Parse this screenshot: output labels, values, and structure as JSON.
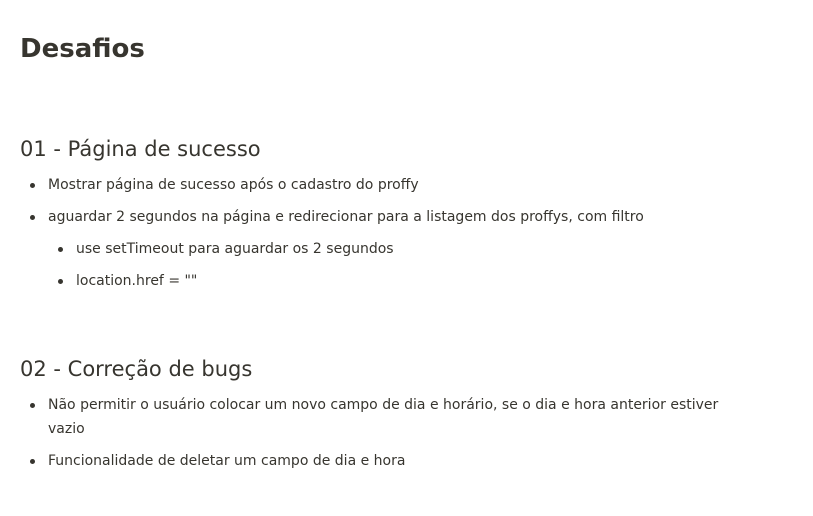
{
  "page": {
    "title": "Desafios"
  },
  "sections": [
    {
      "heading": "01 - Página de sucesso",
      "items": [
        "Mostrar página de sucesso após o cadastro do proffy",
        "aguardar 2 segundos na página e redirecionar para a listagem dos proffys, com filtro"
      ],
      "sub_items": [
        "use setTimeout para aguardar os 2 segundos",
        "location.href = \"\""
      ]
    },
    {
      "heading": "02 - Correção de bugs",
      "items": [
        "Não permitir o usuário colocar um novo campo de dia e horário, se o dia e hora anterior estiver vazio",
        "Funcionalidade de deletar um campo de dia e hora"
      ]
    }
  ]
}
